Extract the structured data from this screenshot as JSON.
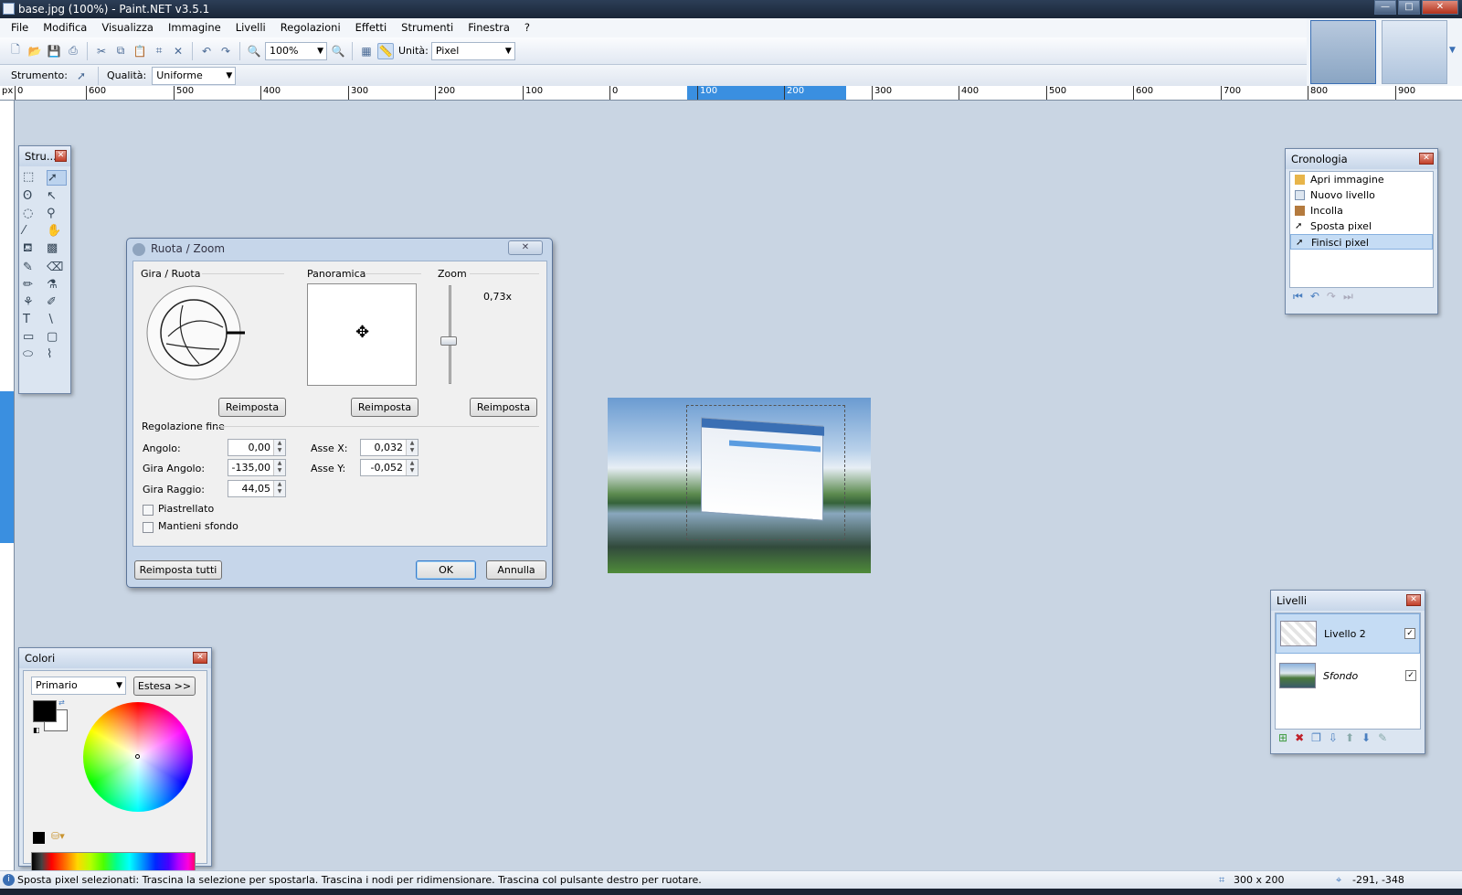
{
  "window": {
    "title": "base.jpg (100%) - Paint.NET v3.5.1",
    "min": "—",
    "max": "□",
    "close": "✕"
  },
  "menu": [
    "File",
    "Modifica",
    "Visualizza",
    "Immagine",
    "Livelli",
    "Regolazioni",
    "Effetti",
    "Strumenti",
    "Finestra",
    "?"
  ],
  "toolbar": {
    "zoom_value": "100%",
    "units_label": "Unità:",
    "units_value": "Pixel"
  },
  "toolbar2": {
    "tool_label": "Strumento:",
    "quality_label": "Qualità:",
    "quality_value": "Uniforme"
  },
  "ruler": {
    "unit": "px",
    "h_labels": [
      "0",
      "600",
      "500",
      "400",
      "300",
      "200",
      "100",
      "0",
      "100",
      "200",
      "300",
      "400",
      "500",
      "600",
      "700",
      "800",
      "900"
    ]
  },
  "tools_panel": {
    "title": "Stru..."
  },
  "dialog": {
    "title": "Ruota / Zoom",
    "section_rotate": "Gira / Ruota",
    "section_pan": "Panoramica",
    "section_zoom": "Zoom",
    "zoom_value": "0,73x",
    "reset": "Reimposta",
    "fine_tune": "Regolazione fine",
    "angle_label": "Angolo:",
    "angle_value": "0,00",
    "tilt_angle_label": "Gira Angolo:",
    "tilt_angle_value": "-135,00",
    "tilt_radius_label": "Gira Raggio:",
    "tilt_radius_value": "44,05",
    "axis_x_label": "Asse X:",
    "axis_x_value": "0,032",
    "axis_y_label": "Asse Y:",
    "axis_y_value": "-0,052",
    "tiled_label": "Piastrellato",
    "keep_bg_label": "Mantieni sfondo",
    "reset_all": "Reimposta tutti",
    "ok": "OK",
    "cancel": "Annulla"
  },
  "history": {
    "title": "Cronologia",
    "items": [
      "Apri immagine",
      "Nuovo livello",
      "Incolla",
      "Sposta pixel",
      "Finisci pixel"
    ],
    "selected_index": 4
  },
  "layers": {
    "title": "Livelli",
    "items": [
      {
        "name": "Livello 2",
        "checked": "✓"
      },
      {
        "name": "Sfondo",
        "checked": "✓"
      }
    ]
  },
  "colors": {
    "title": "Colori",
    "mode": "Primario",
    "more": "Estesa >>",
    "primary": "#000000",
    "secondary": "#ffffff"
  },
  "status": {
    "message": "Sposta pixel selezionati: Trascina la selezione per spostarla. Trascina i nodi per ridimensionare. Trascina col pulsante destro per ruotare.",
    "size": "300 x 200",
    "coords": "-291, -348"
  }
}
